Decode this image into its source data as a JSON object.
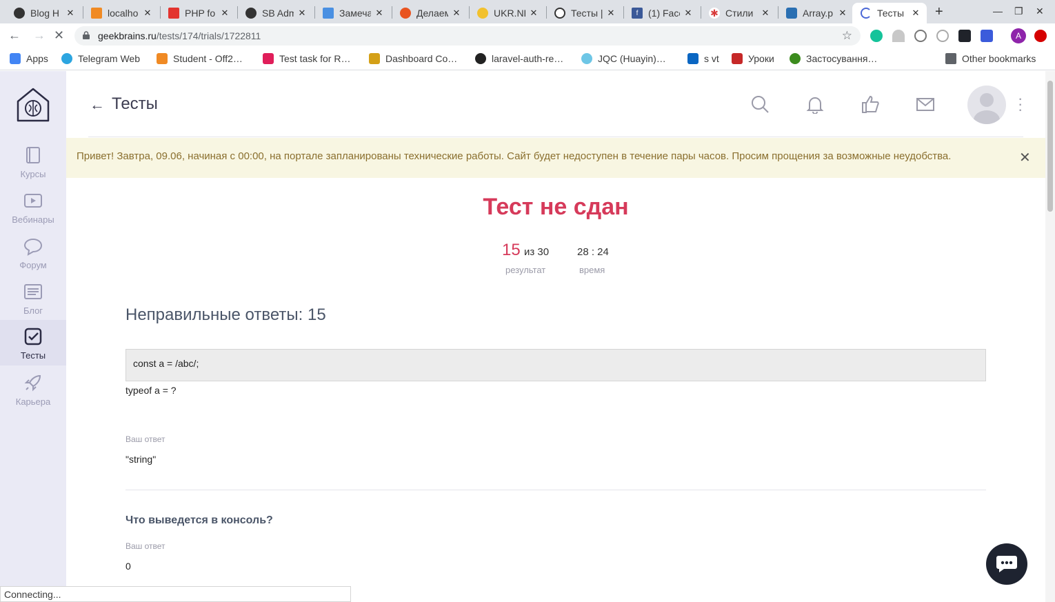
{
  "tabs": [
    {
      "label": "Blog H",
      "icon": "github-icon",
      "color": "#333333"
    },
    {
      "label": "localho",
      "icon": "phpmyadmin-icon",
      "color": "#f08a24"
    },
    {
      "label": "PHP fo",
      "icon": "laravel-icon",
      "color": "#e3342f"
    },
    {
      "label": "SB Adm",
      "icon": "github-icon",
      "color": "#333333"
    },
    {
      "label": "Замеча",
      "icon": "doc-icon",
      "color": "#4a90e2"
    },
    {
      "label": "Делаем",
      "icon": "ubuntu-icon",
      "color": "#e95420"
    },
    {
      "label": "UKR.NE",
      "icon": "ukrnet-icon",
      "color": "#f2c12e"
    },
    {
      "label": "Тесты |",
      "icon": "geekbrains-icon",
      "color": "#333333"
    },
    {
      "label": "(1) Face",
      "icon": "facebook-icon",
      "color": "#3b5998"
    },
    {
      "label": "Стили",
      "icon": "stick-icon",
      "color": "#d83b3b"
    },
    {
      "label": "Array.p",
      "icon": "php-icon",
      "color": "#2a6fb2"
    },
    {
      "label": "Тесты |",
      "icon": "loading-icon",
      "color": "#4a67d6",
      "active": true
    }
  ],
  "address": {
    "domain": "geekbrains.ru",
    "path": "/tests/174/trials/1722811"
  },
  "bookmarks": [
    {
      "label": "Apps",
      "icon": "apps-icon",
      "color": "#4285f4"
    },
    {
      "label": "Telegram Web",
      "icon": "telegram-icon",
      "color": "#2ca5e0"
    },
    {
      "label": "Student - Off2…",
      "icon": "student-icon",
      "color": "#f08a24"
    },
    {
      "label": "Test task for R…",
      "icon": "slack-icon",
      "color": "#e01e5a"
    },
    {
      "label": "Dashboard Co…",
      "icon": "dashboard-icon",
      "color": "#d4a017"
    },
    {
      "label": "laravel-auth-re…",
      "icon": "github-icon",
      "color": "#222222"
    },
    {
      "label": "JQC (Huayin)…",
      "icon": "jqc-icon",
      "color": "#6ec6e6"
    },
    {
      "label": "s vt",
      "icon": "linkedin-icon",
      "color": "#0a66c2"
    },
    {
      "label": "Уроки",
      "icon": "lessons-icon",
      "color": "#c62828"
    },
    {
      "label": "Застосування…",
      "icon": "virus-icon",
      "color": "#3c8c1e"
    },
    {
      "label": "Other bookmarks",
      "icon": "folder-icon",
      "color": "#5f6368"
    }
  ],
  "sidebar": {
    "items": [
      {
        "label": "Курсы",
        "icon": "book-icon"
      },
      {
        "label": "Вебинары",
        "icon": "play-icon"
      },
      {
        "label": "Форум",
        "icon": "chat-bubble-icon"
      },
      {
        "label": "Блог",
        "icon": "newspaper-icon"
      },
      {
        "label": "Тесты",
        "icon": "checkbox-icon",
        "active": true
      },
      {
        "label": "Карьера",
        "icon": "rocket-icon"
      }
    ]
  },
  "header": {
    "title": "Тесты"
  },
  "notice": {
    "text": "Привет! Завтра, 09.06, начиная с 00:00, на портале запланированы технические работы. Сайт будет недоступен в течение пары часов. Просим прощения за возможные неудобства.",
    "close": "✕"
  },
  "result": {
    "title": "Тест не сдан",
    "score": "15",
    "score_of": "из 30",
    "score_label": "результат",
    "time": "28 : 24",
    "time_label": "время"
  },
  "wrong": {
    "heading": "Неправильные ответы: 15",
    "questions": [
      {
        "code": "const a = /abc/;",
        "text": "typeof a = ?",
        "answer_label": "Ваш ответ",
        "answer": "\"string\""
      },
      {
        "text": "Что выведется в консоль?",
        "answer_label": "Ваш ответ",
        "answer": "0"
      }
    ]
  },
  "status": "Connecting..."
}
